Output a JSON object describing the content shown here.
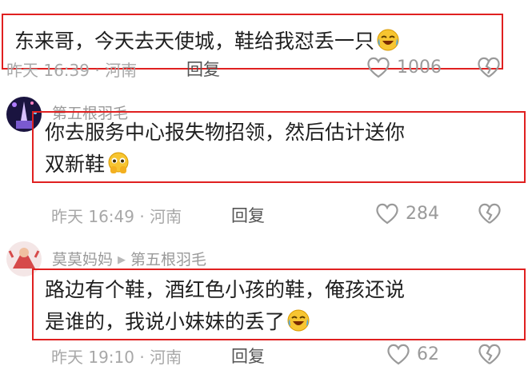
{
  "comments": [
    {
      "username": "",
      "text": "东来哥，今天去天使城，鞋给我怼丢一只",
      "time": "昨天 16:39 · 河南",
      "reply_label": "回复",
      "likes": "1006",
      "emoji": "laughing-crying-emoji"
    },
    {
      "username": "第五根羽毛",
      "text_line1": "你去服务中心报失物招领，然后估计送你",
      "text_line2": "双新鞋",
      "time": "昨天 16:49 · 河南",
      "reply_label": "回复",
      "likes": "284",
      "emoji": "pleading-hands-emoji"
    },
    {
      "username": "莫莫妈妈",
      "reply_to": "第五根羽毛",
      "text_line1": "路边有个鞋，酒红色小孩的鞋，俺孩还说",
      "text_line2": "是谁的，我说小妹妹的丢了",
      "time": "昨天 19:10 · 河南",
      "reply_label": "回复",
      "likes": "62",
      "emoji": "laughing-crying-emoji"
    }
  ],
  "colors": {
    "highlight_border": "#e02020",
    "meta_text": "#a8a8a8",
    "username_text": "#9a9a9a"
  }
}
